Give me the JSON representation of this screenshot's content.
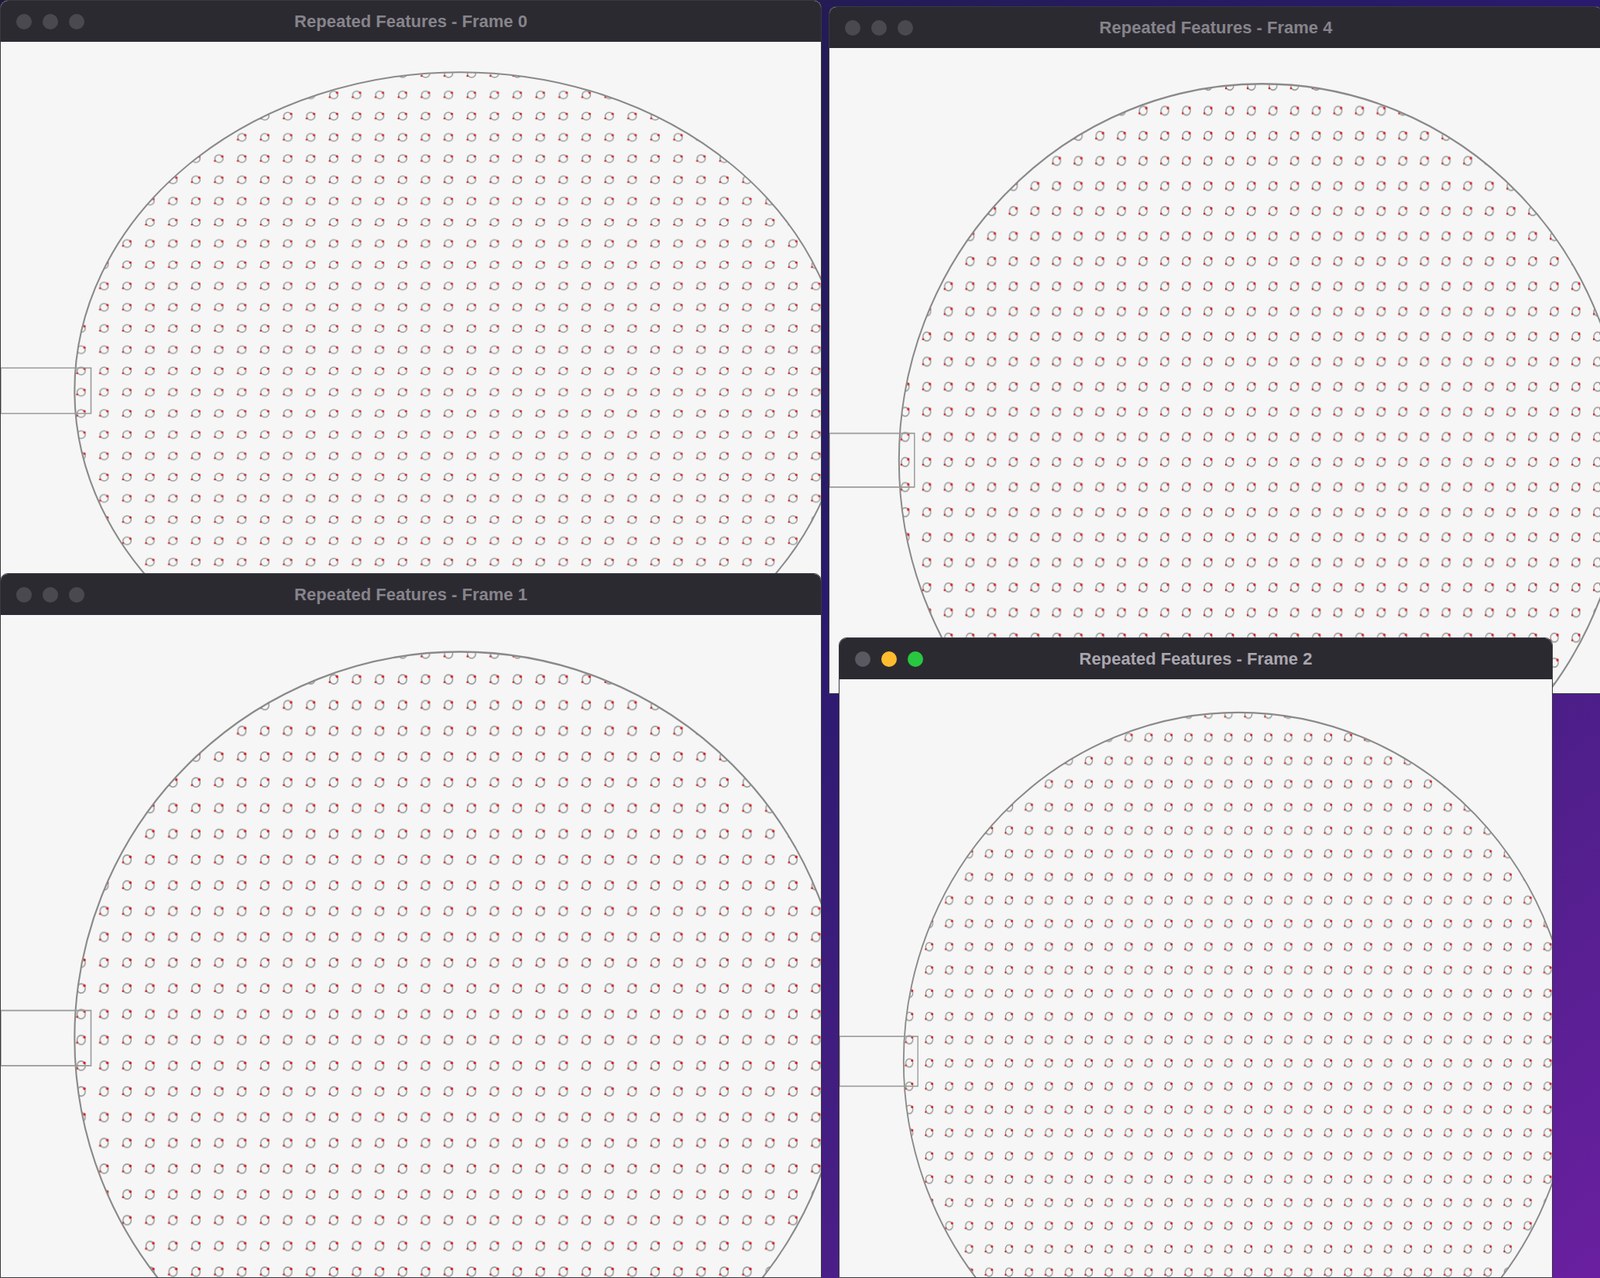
{
  "windows": [
    {
      "title": "Repeated Features - Frame 0",
      "active": false,
      "controls": [
        {
          "color": "#4b4950"
        },
        {
          "color": "#4b4950"
        },
        {
          "color": "#4b4950"
        }
      ]
    },
    {
      "title": "Repeated Features - Frame 1",
      "active": false,
      "controls": [
        {
          "color": "#4b4950"
        },
        {
          "color": "#4b4950"
        },
        {
          "color": "#4b4950"
        }
      ]
    },
    {
      "title": "Repeated Features - Frame 4",
      "active": false,
      "controls": [
        {
          "color": "#4b4950"
        },
        {
          "color": "#4b4950"
        },
        {
          "color": "#4b4950"
        }
      ]
    },
    {
      "title": "Repeated Features - Frame 2",
      "active": true,
      "controls": [
        {
          "color": "#5a5860"
        },
        {
          "color": "#febc2e"
        },
        {
          "color": "#28c840"
        }
      ]
    }
  ]
}
